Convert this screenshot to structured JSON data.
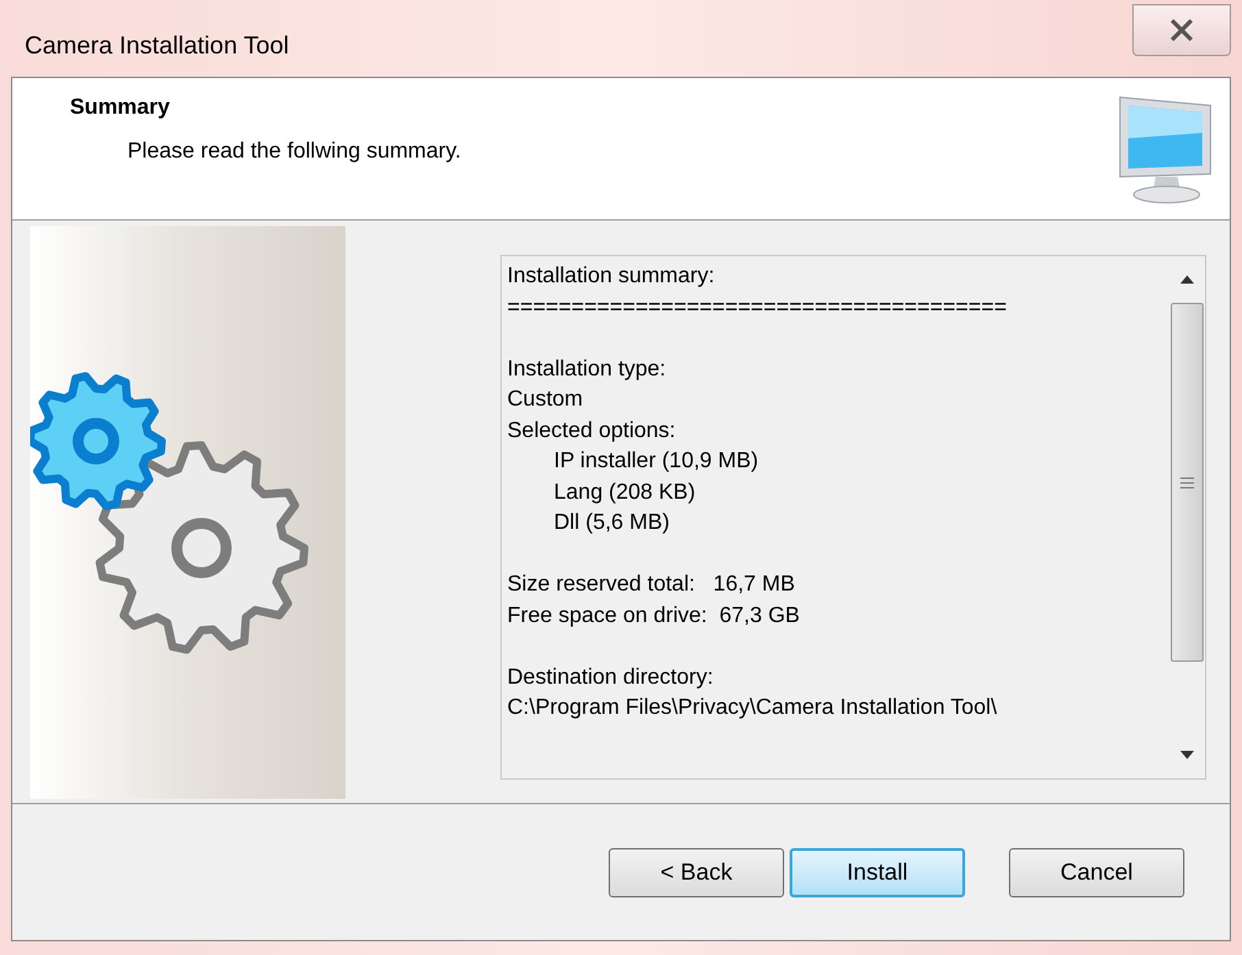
{
  "window": {
    "title": "Camera Installation Tool"
  },
  "header": {
    "title": "Summary",
    "subtitle": "Please read the follwing summary."
  },
  "summary_lines": [
    {
      "text": "Installation summary:",
      "indent": false,
      "gap_before": false
    },
    {
      "text": "=======================================",
      "indent": false,
      "gap_before": false
    },
    {
      "text": "Installation type:",
      "indent": false,
      "gap_before": true
    },
    {
      "text": "Custom",
      "indent": false,
      "gap_before": false
    },
    {
      "text": "Selected options:",
      "indent": false,
      "gap_before": false
    },
    {
      "text": "IP installer (10,9 MB)",
      "indent": true,
      "gap_before": false
    },
    {
      "text": "Lang (208 KB)",
      "indent": true,
      "gap_before": false
    },
    {
      "text": "Dll (5,6 MB)",
      "indent": true,
      "gap_before": false
    },
    {
      "text": "Size reserved total:   16,7 MB",
      "indent": false,
      "gap_before": true
    },
    {
      "text": "Free space on drive:  67,3 GB",
      "indent": false,
      "gap_before": false
    },
    {
      "text": "Destination directory:",
      "indent": false,
      "gap_before": true
    },
    {
      "text": "C:\\Program Files\\Privacy\\Camera Installation Tool\\",
      "indent": false,
      "gap_before": false
    }
  ],
  "buttons": [
    {
      "label": "< Back",
      "default": false
    },
    {
      "label": "Install",
      "default": true
    },
    {
      "label": "Cancel",
      "default": false
    }
  ]
}
